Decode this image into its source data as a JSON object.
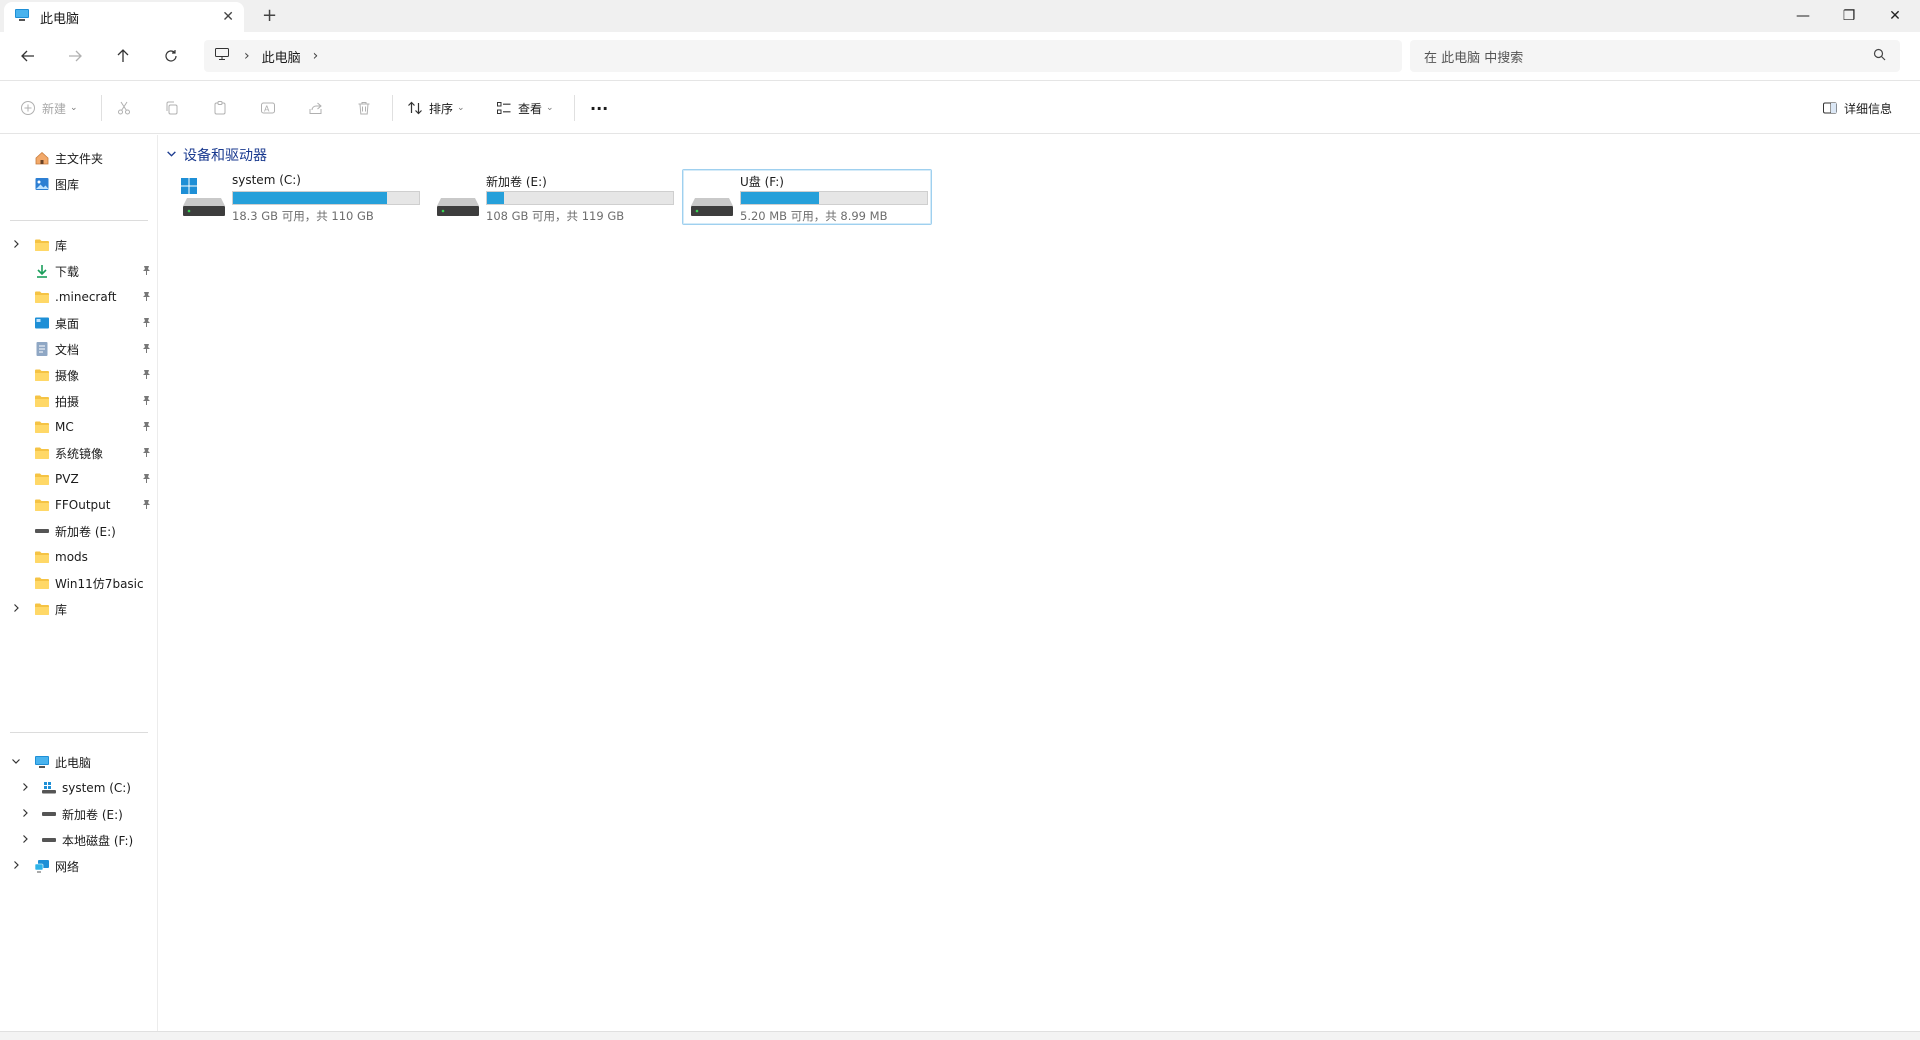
{
  "tab": {
    "title": "此电脑",
    "close": "✕",
    "new": "+"
  },
  "window_controls": {
    "minimize": "—",
    "maximize": "❐",
    "close": "✕"
  },
  "address": {
    "crumb": "此电脑",
    "sep1": "›",
    "sep2": "›"
  },
  "search": {
    "placeholder": "在 此电脑 中搜索"
  },
  "toolbar": {
    "new_label": "新建",
    "sort_label": "排序",
    "view_label": "查看",
    "more_label": "···",
    "details_label": "详细信息"
  },
  "sidebar": {
    "quick": [
      {
        "label": "主文件夹",
        "icon": "home-icon"
      },
      {
        "label": "图库",
        "icon": "gallery-icon"
      }
    ],
    "pinned": [
      {
        "label": "库",
        "icon": "folder-icon",
        "expandable": true,
        "pinned": false
      },
      {
        "label": "下载",
        "icon": "download-icon",
        "expandable": false,
        "pinned": true
      },
      {
        "label": ".minecraft",
        "icon": "folder-icon",
        "expandable": false,
        "pinned": true
      },
      {
        "label": "桌面",
        "icon": "desktop-icon",
        "expandable": false,
        "pinned": true
      },
      {
        "label": "文档",
        "icon": "document-icon",
        "expandable": false,
        "pinned": true
      },
      {
        "label": "摄像",
        "icon": "folder-icon",
        "expandable": false,
        "pinned": true
      },
      {
        "label": "拍摄",
        "icon": "folder-icon",
        "expandable": false,
        "pinned": true
      },
      {
        "label": "MC",
        "icon": "folder-icon",
        "expandable": false,
        "pinned": true
      },
      {
        "label": "系统镜像",
        "icon": "folder-icon",
        "expandable": false,
        "pinned": true
      },
      {
        "label": "PVZ",
        "icon": "folder-icon",
        "expandable": false,
        "pinned": true
      },
      {
        "label": "FFOutput",
        "icon": "folder-icon",
        "expandable": false,
        "pinned": true
      },
      {
        "label": "新加卷 (E:)",
        "icon": "drive-icon",
        "expandable": false,
        "pinned": false
      },
      {
        "label": "mods",
        "icon": "folder-icon",
        "expandable": false,
        "pinned": false
      },
      {
        "label": "Win11仿7basic",
        "icon": "folder-icon",
        "expandable": false,
        "pinned": false
      },
      {
        "label": "库",
        "icon": "folder-icon",
        "expandable": true,
        "pinned": false
      }
    ],
    "this_pc": {
      "label": "此电脑",
      "icon": "computer-icon"
    },
    "drives": [
      {
        "label": "system (C:)",
        "icon": "windows-drive-icon"
      },
      {
        "label": "新加卷 (E:)",
        "icon": "drive-icon"
      },
      {
        "label": "本地磁盘 (F:)",
        "icon": "drive-icon"
      }
    ],
    "network": {
      "label": "网络",
      "icon": "network-icon"
    },
    "chev_right": "›",
    "chev_down": "⌄",
    "pin": "📌"
  },
  "content": {
    "group_title": "设备和驱动器",
    "drives": [
      {
        "name": "system (C:)",
        "info": "18.3 GB 可用，共 110 GB",
        "used_fraction": 0.83,
        "selected": false,
        "icon": "windows-drive-icon"
      },
      {
        "name": "新加卷 (E:)",
        "info": "108 GB 可用，共 119 GB",
        "used_fraction": 0.09,
        "selected": false,
        "icon": "drive-icon"
      },
      {
        "name": "U盘 (F:)",
        "info": "5.20 MB 可用，共 8.99 MB",
        "used_fraction": 0.42,
        "selected": true,
        "icon": "drive-icon"
      }
    ]
  },
  "colors": {
    "accent": "#26a0da",
    "folder": "#f5c344",
    "group_header": "#1a3a8f"
  }
}
